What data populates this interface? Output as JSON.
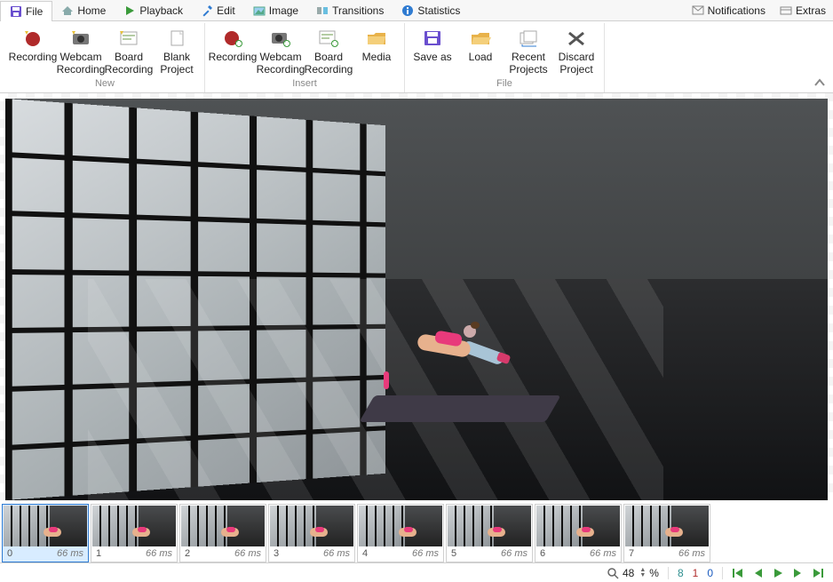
{
  "tabs": {
    "file": "File",
    "home": "Home",
    "playback": "Playback",
    "edit": "Edit",
    "image": "Image",
    "transitions": "Transitions",
    "statistics": "Statistics",
    "notifications": "Notifications",
    "extras": "Extras"
  },
  "ribbon": {
    "new": {
      "label": "New",
      "recording": "Recording",
      "webcam": "Webcam Recording",
      "board": "Board Recording",
      "blank": "Blank Project"
    },
    "insert": {
      "label": "Insert",
      "recording": "Recording",
      "webcam": "Webcam Recording",
      "board": "Board Recording",
      "media": "Media"
    },
    "file": {
      "label": "File",
      "saveas": "Save as",
      "load": "Load",
      "recent": "Recent Projects",
      "discard": "Discard Project"
    },
    "collapse": "▲"
  },
  "frames": [
    {
      "index": 0,
      "duration": "66 ms",
      "selected": true
    },
    {
      "index": 1,
      "duration": "66 ms",
      "selected": false
    },
    {
      "index": 2,
      "duration": "66 ms",
      "selected": false
    },
    {
      "index": 3,
      "duration": "66 ms",
      "selected": false
    },
    {
      "index": 4,
      "duration": "66 ms",
      "selected": false
    },
    {
      "index": 5,
      "duration": "66 ms",
      "selected": false
    },
    {
      "index": 6,
      "duration": "66 ms",
      "selected": false
    },
    {
      "index": 7,
      "duration": "66 ms",
      "selected": false
    }
  ],
  "status": {
    "zoom_value": "48",
    "zoom_unit": "%",
    "count_a": "8",
    "count_b": "1",
    "count_c": "0"
  },
  "icons": {
    "save": "floppy",
    "home": "home",
    "playback": "play",
    "edit": "pencil",
    "image": "image",
    "transitions": "transitions",
    "statistics": "info"
  },
  "colors": {
    "accent_blue": "#2f7bd1",
    "record_red": "#b02a2a",
    "nav_green": "#3a9a3a"
  }
}
